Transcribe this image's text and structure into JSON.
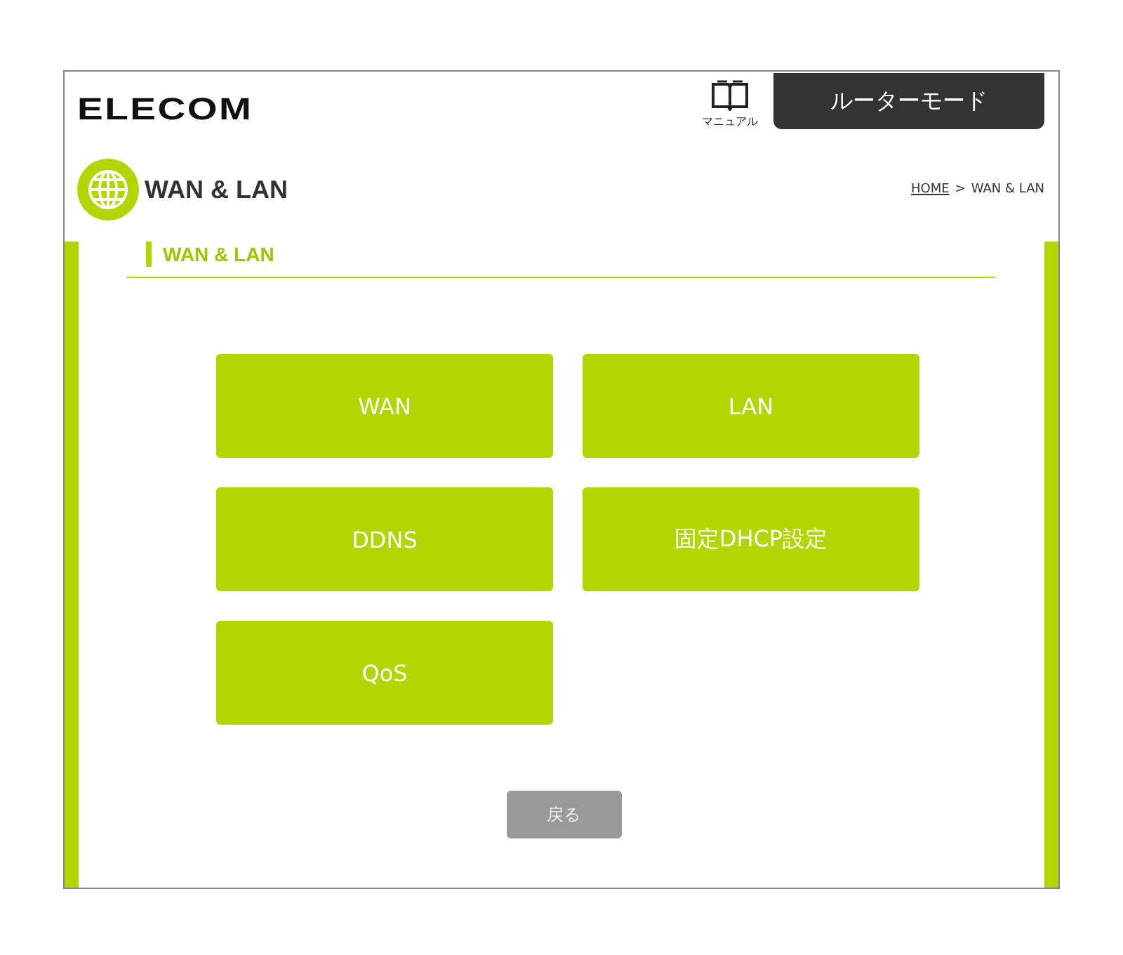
{
  "header": {
    "logo": "ELECOM",
    "manual_label": "マニュアル",
    "mode_tab": "ルーターモード"
  },
  "page_title": "WAN & LAN",
  "breadcrumb": {
    "home": "HOME",
    "separator": ">",
    "current": "WAN & LAN"
  },
  "section_heading": "WAN & LAN",
  "menu_buttons": [
    "WAN",
    "LAN",
    "DDNS",
    "固定DHCP設定",
    "QoS"
  ],
  "back_button": "戻る"
}
